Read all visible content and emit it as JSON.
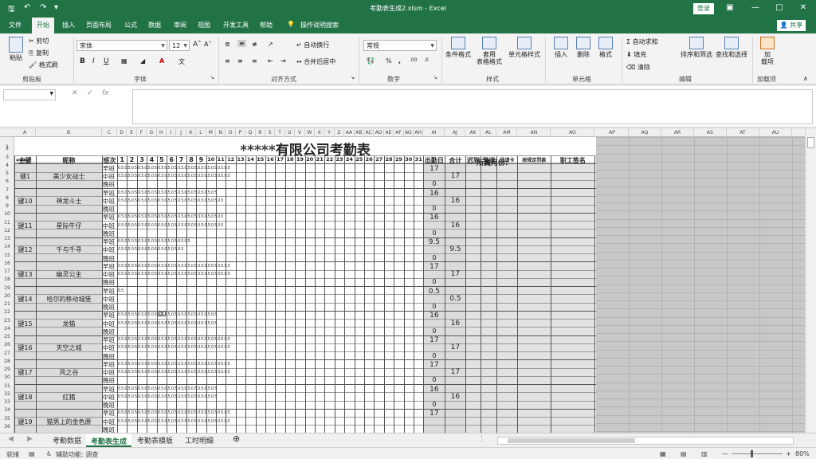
{
  "window": {
    "title": "考勤表生成2.xlsm  -  Excel",
    "login": "登录"
  },
  "qat": {
    "save_icon": "save-icon",
    "undo_icon": "undo-icon",
    "redo_icon": "redo-icon"
  },
  "tabs": [
    "文件",
    "开始",
    "插入",
    "页面布局",
    "公式",
    "数据",
    "审阅",
    "视图",
    "开发工具",
    "帮助"
  ],
  "tell_me": "操作说明搜索",
  "share": "共享",
  "ribbon": {
    "clipboard": {
      "paste": "粘贴",
      "cut": "剪切",
      "copy": "复制",
      "format_painter": "格式刷",
      "label": "剪贴板"
    },
    "font": {
      "name": "宋体",
      "size": "12",
      "label": "字体",
      "bold": "B",
      "italic": "I",
      "underline": "U"
    },
    "alignment": {
      "wrap": "自动换行",
      "merge": "合并后居中",
      "label": "对齐方式"
    },
    "number": {
      "format": "常规",
      "label": "数字"
    },
    "styles": {
      "cond": "条件格式",
      "table": "套用\n表格格式",
      "cell": "单元格样式",
      "label": "样式"
    },
    "cells": {
      "insert": "插入",
      "delete": "删除",
      "format": "格式",
      "label": "单元格"
    },
    "editing": {
      "autosum": "自动求和",
      "fill": "填充",
      "clear": "清除",
      "sort": "排序和筛选",
      "find": "查找和选择",
      "label": "编辑"
    },
    "addins": {
      "addin": "加\n载项",
      "label": "加载项"
    }
  },
  "formula_bar": {
    "fx": "fx"
  },
  "columns": [
    "A",
    "B",
    "C",
    "D",
    "E",
    "F",
    "G",
    "H",
    "I",
    "J",
    "K",
    "L",
    "M",
    "N",
    "O",
    "P",
    "Q",
    "R",
    "S",
    "T",
    "U",
    "V",
    "W",
    "X",
    "Y",
    "Z",
    "AA",
    "AB",
    "AC",
    "AD",
    "AE",
    "AF",
    "AG",
    "AH",
    "AI",
    "AJ",
    "AK",
    "AL",
    "AM",
    "AN",
    "AO",
    "AP",
    "AQ",
    "AR",
    "AS",
    "AT",
    "AU"
  ],
  "sheet": {
    "title": "*****有限公司考勤表",
    "row2_left": "***:",
    "row2_right": "所属月份:",
    "headers": {
      "key": "主键",
      "nick": "昵称",
      "shift": "班次",
      "days": [
        "1",
        "2",
        "3",
        "4",
        "5",
        "6",
        "7",
        "8",
        "9",
        "10",
        "11",
        "12",
        "13",
        "14",
        "15",
        "16",
        "17",
        "18",
        "19",
        "20",
        "21",
        "22",
        "23",
        "24",
        "25",
        "26",
        "27",
        "28",
        "29",
        "30",
        "31"
      ],
      "attend": "出勤日",
      "total": "合计",
      "late": "迟到",
      "early": "早退",
      "unpaid": "没请卡",
      "penalty": "按规定罚款",
      "sign": "职工签名"
    },
    "shifts": [
      "早班",
      "中班",
      "晚班"
    ],
    "employees": [
      {
        "key": "键1",
        "nick": "美少女战士",
        "a": "17",
        "b": "0",
        "total": "17"
      },
      {
        "key": "键10",
        "nick": "神龙斗士",
        "a": "16",
        "b": "0",
        "total": "16"
      },
      {
        "key": "键11",
        "nick": "星际牛仔",
        "a": "16",
        "b": "0",
        "total": "16"
      },
      {
        "key": "键12",
        "nick": "千与千寻",
        "a": "9.5",
        "b": "0",
        "total": "9.5"
      },
      {
        "key": "键13",
        "nick": "幽灵公主",
        "a": "17",
        "b": "0",
        "total": "17"
      },
      {
        "key": "键14",
        "nick": "哈尔的移动城堡",
        "a": "0.5",
        "b": "0",
        "total": "0.5"
      },
      {
        "key": "键15",
        "nick": "龙猫",
        "a": "16",
        "b": "0",
        "total": "16"
      },
      {
        "key": "键16",
        "nick": "天空之城",
        "a": "17",
        "b": "0",
        "total": "17"
      },
      {
        "key": "键17",
        "nick": "风之谷",
        "a": "17",
        "b": "0",
        "total": "17"
      },
      {
        "key": "键18",
        "nick": "红猪",
        "a": "16",
        "b": "0",
        "total": "16"
      },
      {
        "key": "键19",
        "nick": "猫男上的金色原",
        "a": "17",
        "b": "",
        "total": ""
      }
    ]
  },
  "sheet_tabs": [
    "考勤数据",
    "考勤表生成",
    "考勤表模板",
    "工时明细"
  ],
  "status": {
    "ready": "就绪",
    "accessibility": "辅助功能: 调查",
    "zoom": "80%"
  }
}
